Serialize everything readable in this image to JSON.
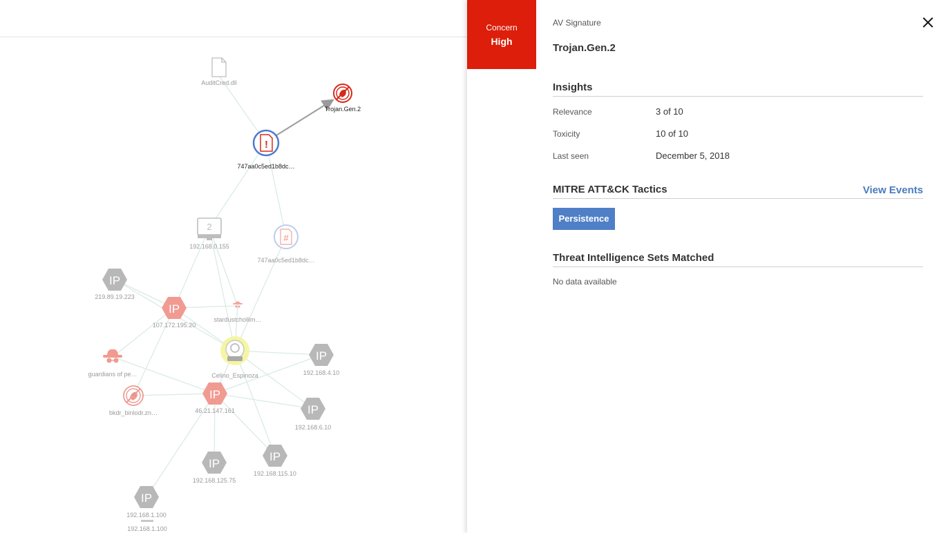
{
  "graph": {
    "nodes": [
      {
        "id": "auditcred",
        "label": "AuditCred.dll",
        "icon": "file-icon"
      },
      {
        "id": "trojan",
        "label": "Trojan.Gen.2",
        "icon": "av-signature-icon"
      },
      {
        "id": "hash-main",
        "label": "747aa0c5ed1b8dc…",
        "icon": "malicious-file-icon"
      },
      {
        "id": "host",
        "label": "192.168.0.155",
        "icon": "computer-icon",
        "badge": "2"
      },
      {
        "id": "hash-2",
        "label": "747aa0c5ed1b8dc…",
        "icon": "hash-file-icon"
      },
      {
        "id": "ip-219",
        "label": "219.89.19.223",
        "icon": "ip-icon",
        "text": "IP"
      },
      {
        "id": "ip-107",
        "label": "107.172.195.20",
        "icon": "ip-icon",
        "text": "IP"
      },
      {
        "id": "stardust",
        "label": "stardustchollim…",
        "icon": "threat-actor-icon"
      },
      {
        "id": "guardians",
        "label": "guardians of pe…",
        "icon": "threat-actor-icon"
      },
      {
        "id": "user",
        "label": "Celino_Espinoza",
        "icon": "user-icon"
      },
      {
        "id": "ip-4-10",
        "label": "192.168.4.10",
        "icon": "ip-icon",
        "text": "IP"
      },
      {
        "id": "bkdr",
        "label": "bkdr_binlodr.zn…",
        "icon": "av-signature-icon"
      },
      {
        "id": "ip-46",
        "label": "46.21.147.161",
        "icon": "ip-icon",
        "text": "IP"
      },
      {
        "id": "ip-6-10",
        "label": "192.168.6.10",
        "icon": "ip-icon",
        "text": "IP"
      },
      {
        "id": "ip-125",
        "label": "192.168.125.75",
        "icon": "ip-icon",
        "text": "IP"
      },
      {
        "id": "ip-115",
        "label": "192.168.115.10",
        "icon": "ip-icon",
        "text": "IP"
      },
      {
        "id": "ip-1-100",
        "label": "192.168.1.100",
        "icon": "ip-icon",
        "text": "IP"
      },
      {
        "id": "host-1-100",
        "label": "192.168.1.100",
        "icon": "computer-icon"
      }
    ],
    "colors": {
      "red": "#f08a80",
      "grey": "#b8b8b8",
      "selected": "#4a7bd0",
      "edge": "#d8ece6",
      "user_glow": "#f4f59a"
    }
  },
  "panel": {
    "concern_label": "Concern",
    "concern_level": "High",
    "concern_color": "#dc1e0a",
    "sig_type": "AV Signature",
    "sig_name": "Trojan.Gen.2",
    "insights": {
      "title": "Insights",
      "rows": [
        {
          "key": "Relevance",
          "value": "3 of 10"
        },
        {
          "key": "Toxicity",
          "value": "10 of 10"
        },
        {
          "key": "Last seen",
          "value": "December 5, 2018"
        }
      ]
    },
    "mitre": {
      "title": "MITRE ATT&CK Tactics",
      "view_events": "View Events",
      "tactics": [
        "Persistence"
      ]
    },
    "threat_intel": {
      "title": "Threat Intelligence Sets Matched",
      "empty": "No data available"
    }
  }
}
